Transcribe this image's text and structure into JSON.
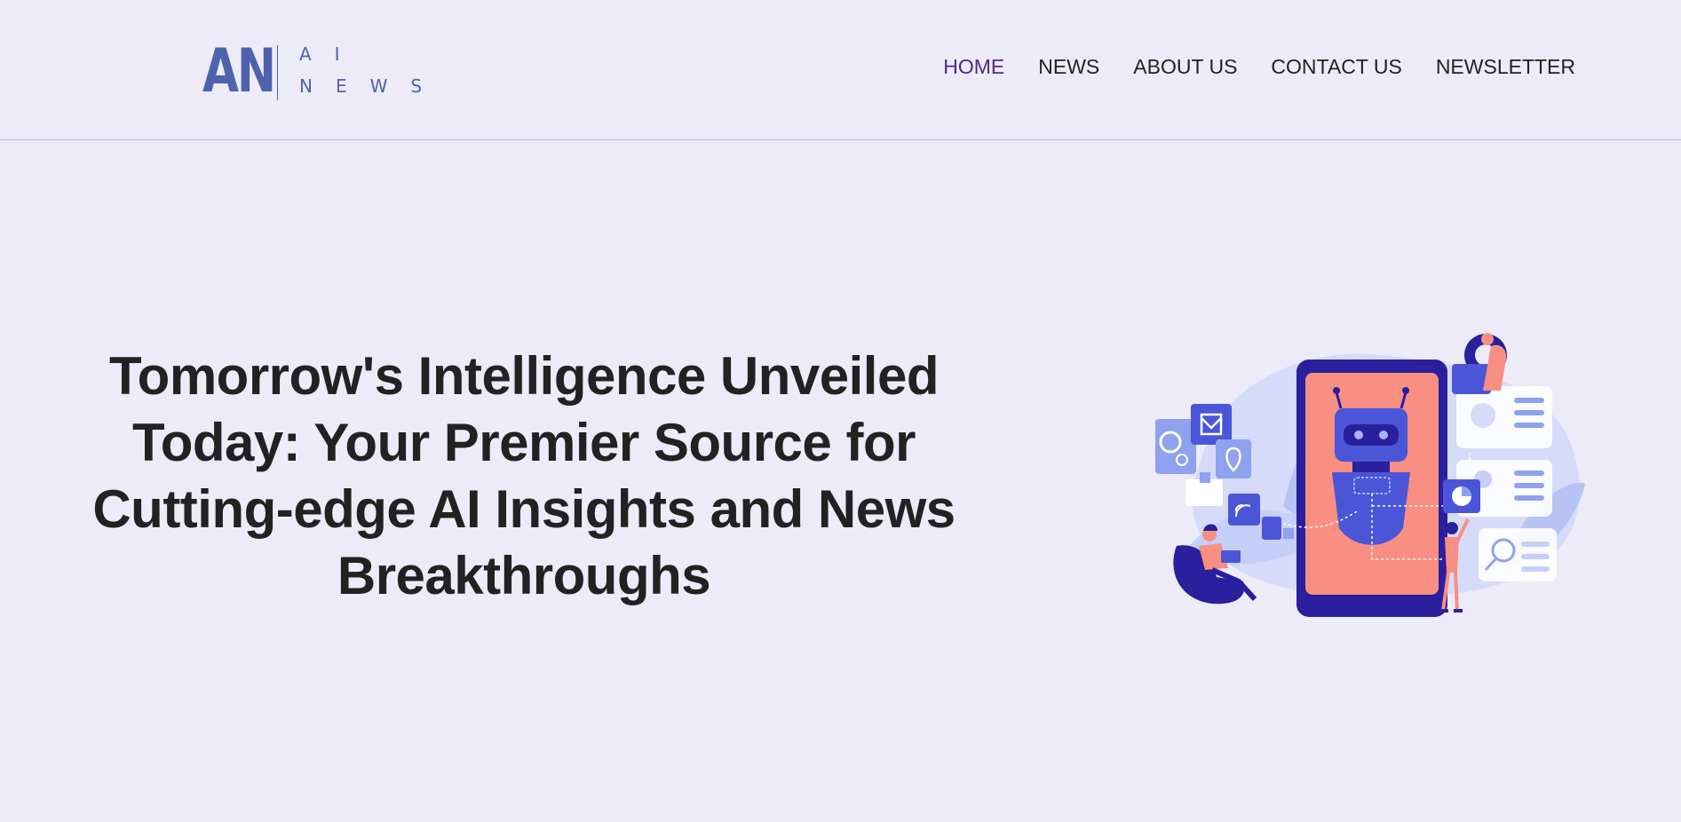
{
  "logo": {
    "mark": "AN",
    "line1": "AI",
    "line2": "NEWS"
  },
  "nav": {
    "items": [
      {
        "label": "HOME",
        "active": true
      },
      {
        "label": "NEWS",
        "active": false
      },
      {
        "label": "ABOUT US",
        "active": false
      },
      {
        "label": "CONTACT US",
        "active": false
      },
      {
        "label": "NEWSLETTER",
        "active": false
      }
    ]
  },
  "hero": {
    "title_lines": [
      "Tomorrow's Intelligence Unveiled",
      "Today: Your Premier Source for",
      "Cutting-edge AI Insights and News",
      "Breakthroughs"
    ],
    "illustration": "robot-on-smartphone-illustration"
  },
  "colors": {
    "background": "#edebf7",
    "brand": "#4f62ad",
    "active_nav": "#4e2a86",
    "text": "#222222",
    "divider": "#b9b5ea"
  }
}
